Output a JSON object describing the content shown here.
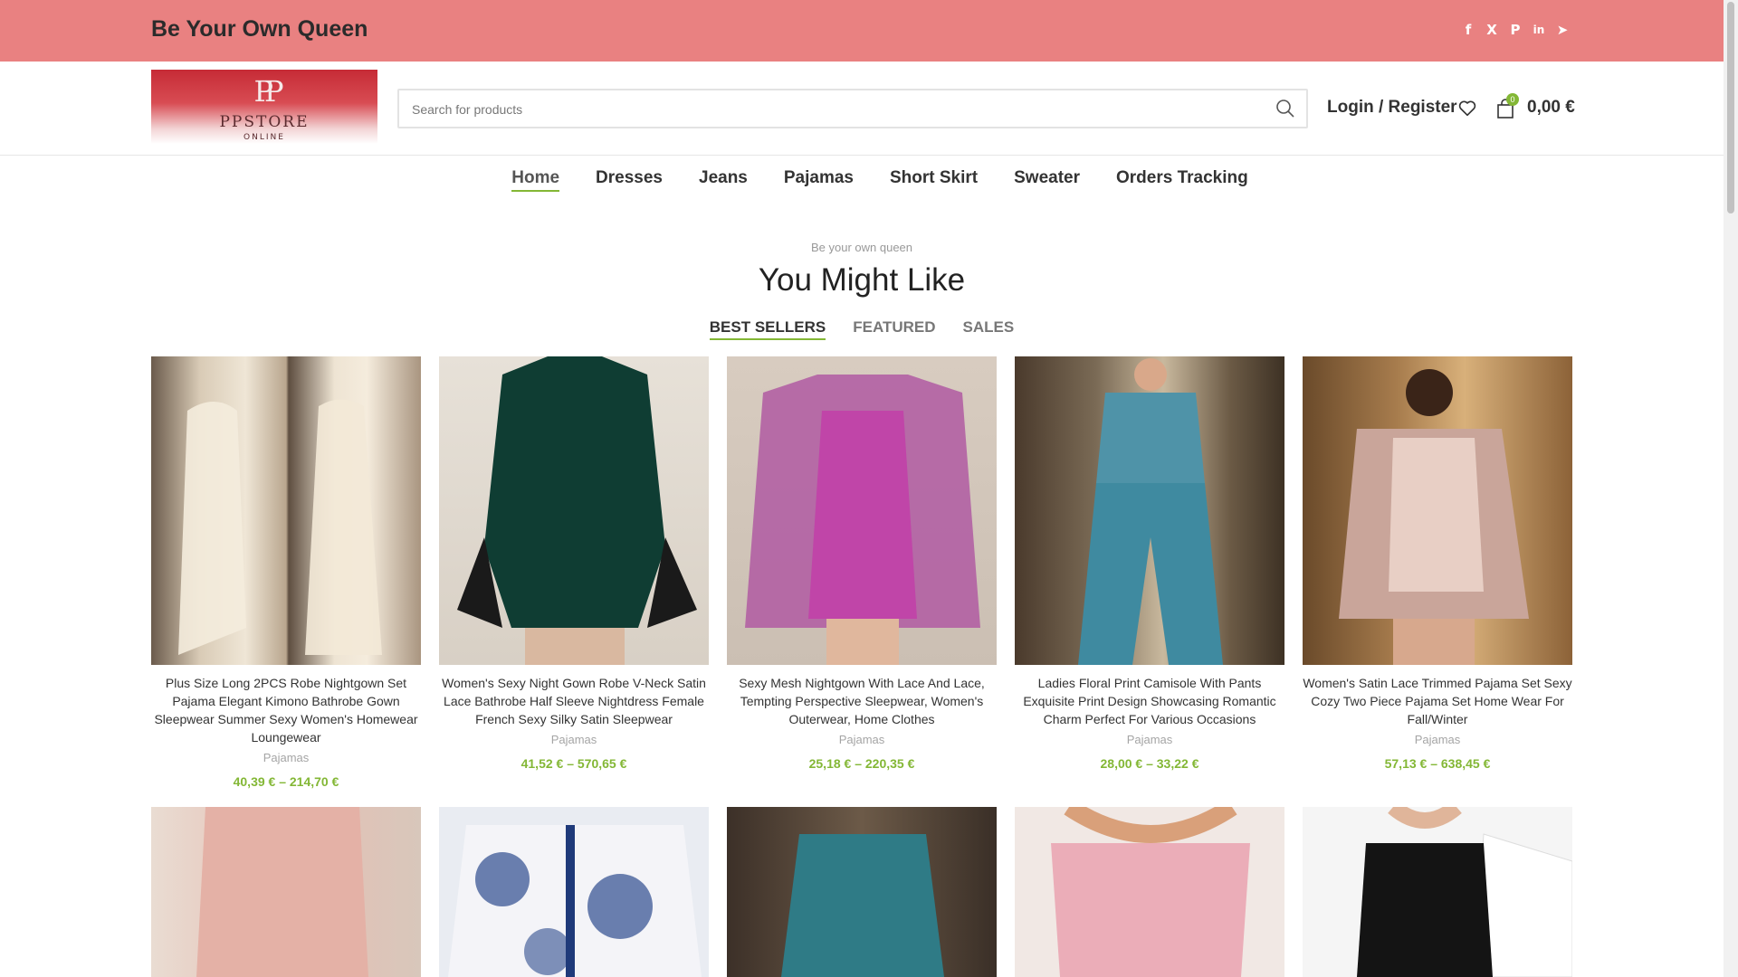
{
  "topbar": {
    "tagline": "Be Your Own Queen",
    "socials": [
      {
        "icon": "facebook-icon",
        "glyph": "f"
      },
      {
        "icon": "x-icon",
        "glyph": "X"
      },
      {
        "icon": "pinterest-icon",
        "glyph": "P"
      },
      {
        "icon": "linkedin-icon",
        "glyph": "in"
      },
      {
        "icon": "telegram-icon",
        "glyph": "➤"
      }
    ]
  },
  "header": {
    "logo_text": "PPSTORE",
    "logo_sub": "ONLINE",
    "logo_mark": "PP",
    "search_placeholder": "Search for products",
    "login_label": "Login / Register",
    "cart_count": "0",
    "cart_total": "0,00 €"
  },
  "nav": {
    "items": [
      "Home",
      "Dresses",
      "Jeans",
      "Pajamas",
      "Short Skirt",
      "Sweater",
      "Orders Tracking"
    ]
  },
  "section": {
    "kicker": "Be your own queen",
    "heading": "You Might Like",
    "tabs": [
      "BEST SELLERS",
      "FEATURED",
      "SALES"
    ]
  },
  "products": [
    {
      "title": "Plus Size Long 2PCS Robe Nightgown Set Pajama Elegant Kimono Bathrobe Gown Sleepwear Summer Sexy Women's Homewear Loungewear",
      "category": "Pajamas",
      "price": "40,39 € – 214,70 €"
    },
    {
      "title": "Women's Sexy Night Gown Robe V-Neck Satin Lace Bathrobe Half Sleeve Nightdress Female French Sexy Silky Satin Sleepwear",
      "category": "Pajamas",
      "price": "41,52 € – 570,65 €"
    },
    {
      "title": "Sexy Mesh Nightgown With Lace And Lace, Tempting Perspective Sleepwear, Women's Outerwear, Home Clothes",
      "category": "Pajamas",
      "price": "25,18 € – 220,35 €"
    },
    {
      "title": "Ladies Floral Print Camisole With Pants Exquisite Print Design Showcasing Romantic Charm Perfect For Various Occasions",
      "category": "Pajamas",
      "price": "28,00 € – 33,22 €"
    },
    {
      "title": "Women's Satin Lace Trimmed Pajama Set Sexy Cozy Two Piece Pajama Set Home Wear For Fall/Winter",
      "category": "Pajamas",
      "price": "57,13 € – 638,45 €"
    }
  ],
  "colors": {
    "topbar": "#e98181",
    "accent": "#83b735"
  }
}
